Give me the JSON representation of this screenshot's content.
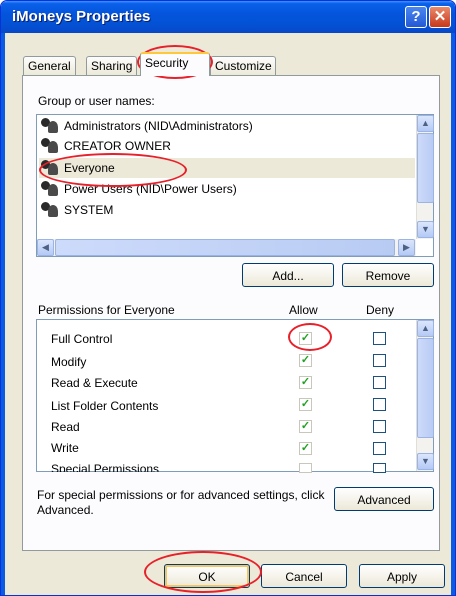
{
  "window": {
    "title": "iMoneys Properties",
    "help_glyph": "?",
    "close_glyph": "✕"
  },
  "tabs": [
    {
      "label": "General"
    },
    {
      "label": "Sharing"
    },
    {
      "label": "Security"
    },
    {
      "label": "Customize"
    }
  ],
  "users": {
    "heading": "Group or user names:",
    "items": [
      {
        "label": "Administrators (NID\\Administrators)"
      },
      {
        "label": "CREATOR OWNER"
      },
      {
        "label": "Everyone"
      },
      {
        "label": "Power Users (NID\\Power Users)"
      },
      {
        "label": "SYSTEM"
      }
    ],
    "add_label": "Add...",
    "remove_label": "Remove"
  },
  "permissions": {
    "heading": "Permissions for Everyone",
    "allow_header": "Allow",
    "deny_header": "Deny",
    "rows": [
      {
        "label": "Full Control",
        "allow": true,
        "deny": false
      },
      {
        "label": "Modify",
        "allow": true,
        "deny": false
      },
      {
        "label": "Read & Execute",
        "allow": true,
        "deny": false
      },
      {
        "label": "List Folder Contents",
        "allow": true,
        "deny": false
      },
      {
        "label": "Read",
        "allow": true,
        "deny": false
      },
      {
        "label": "Write",
        "allow": true,
        "deny": false
      },
      {
        "label": "Special Permissions",
        "allow": false,
        "deny": false
      }
    ],
    "check_glyph": "✓"
  },
  "advanced": {
    "text": "For special permissions or for advanced settings, click Advanced.",
    "button_label": "Advanced"
  },
  "footer": {
    "ok_label": "OK",
    "cancel_label": "Cancel",
    "apply_label": "Apply"
  },
  "scroll_glyphs": {
    "up": "▲",
    "down": "▼",
    "left": "◀",
    "right": "▶"
  },
  "colors": {
    "highlight": "#e8202a",
    "titlebar": "#0455dc",
    "check": "#21a121"
  }
}
